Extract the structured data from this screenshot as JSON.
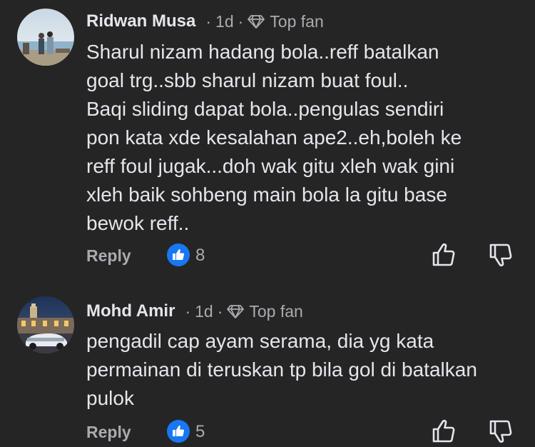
{
  "comments": [
    {
      "author": "Ridwan Musa",
      "time": "1d",
      "badge": "Top fan",
      "text": "Sharul nizam hadang bola..reff batalkan\ngoal trg..sbb sharul nizam buat foul..\nBaqi sliding dapat bola..pengulas sendiri\npon kata xde kesalahan ape2..eh,boleh ke\nreff foul jugak...doh wak gitu xleh wak gini\nxleh baik sohbeng main bola la gitu base\nbewok reff..",
      "reply_label": "Reply",
      "likes": "8"
    },
    {
      "author": "Mohd Amir",
      "time": "1d",
      "badge": "Top fan",
      "text": "pengadil cap ayam serama, dia yg kata\npermainan di teruskan tp bila gol di batalkan\npulok",
      "reply_label": "Reply",
      "likes": "5"
    }
  ],
  "separator": "·",
  "icons": {
    "top_fan": "diamond-icon",
    "like_badge": "thumbs-up-icon",
    "upvote": "upvote-icon",
    "downvote": "downvote-icon"
  },
  "colors": {
    "background": "#252526",
    "text": "#e4e6eb",
    "secondary": "#a9abaf",
    "like_blue": "#1877f2"
  }
}
